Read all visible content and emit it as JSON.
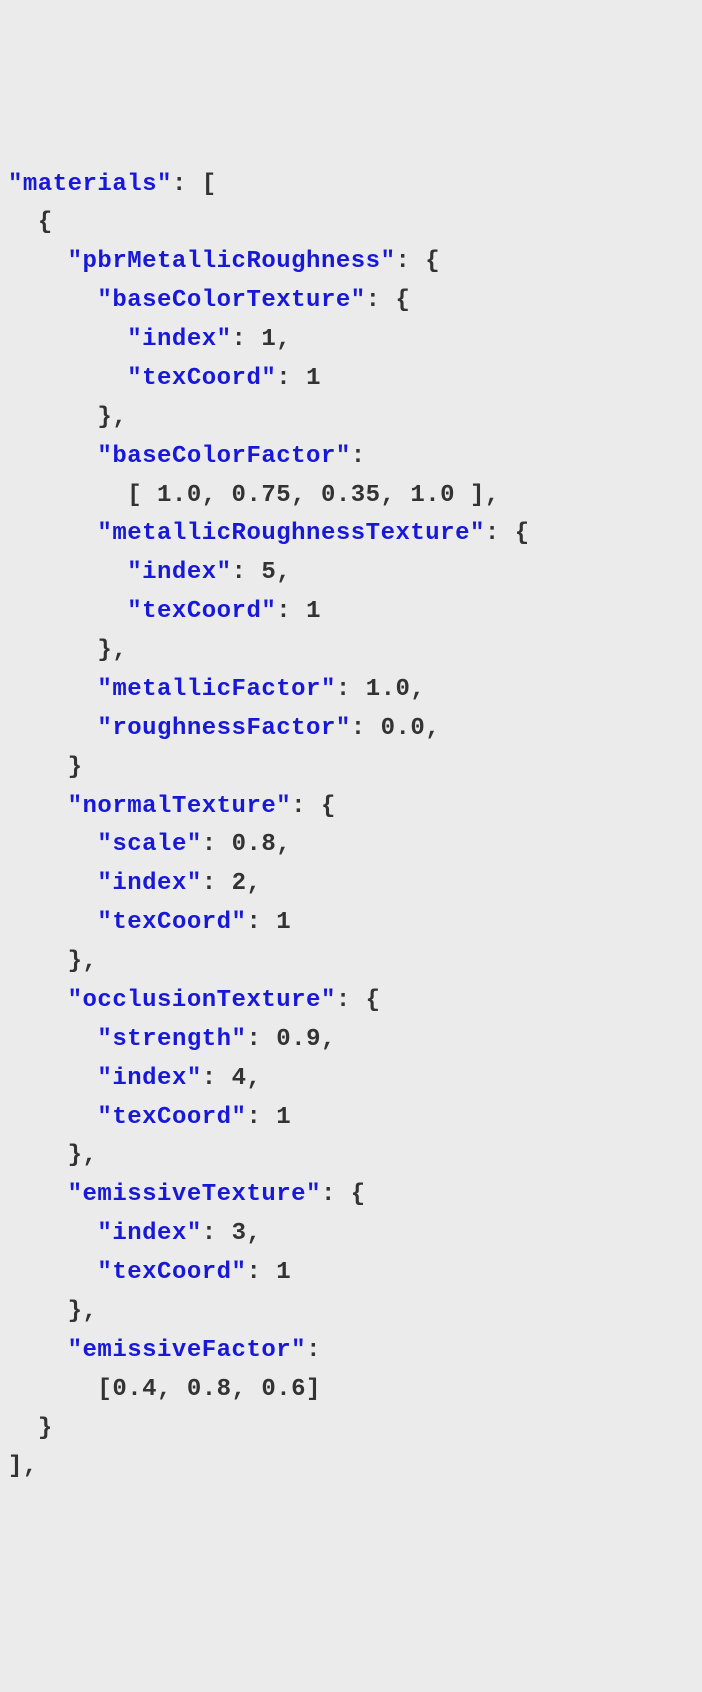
{
  "code": {
    "rootKey": "materials",
    "keys": {
      "pbrMetallicRoughness": "pbrMetallicRoughness",
      "baseColorTexture": "baseColorTexture",
      "index": "index",
      "texCoord": "texCoord",
      "baseColorFactor": "baseColorFactor",
      "metallicRoughnessTexture": "metallicRoughnessTexture",
      "metallicFactor": "metallicFactor",
      "roughnessFactor": "roughnessFactor",
      "normalTexture": "normalTexture",
      "scale": "scale",
      "occlusionTexture": "occlusionTexture",
      "strength": "strength",
      "emissiveTexture": "emissiveTexture",
      "emissiveFactor": "emissiveFactor"
    },
    "values": {
      "baseColorTexture_index": "1",
      "baseColorTexture_texCoord": "1",
      "baseColorFactor_array": "[ 1.0, 0.75, 0.35, 1.0 ]",
      "metallicRoughnessTexture_index": "5",
      "metallicRoughnessTexture_texCoord": "1",
      "metallicFactor": "1.0",
      "roughnessFactor": "0.0",
      "normalTexture_scale": "0.8",
      "normalTexture_index": "2",
      "normalTexture_texCoord": "1",
      "occlusionTexture_strength": "0.9",
      "occlusionTexture_index": "4",
      "occlusionTexture_texCoord": "1",
      "emissiveTexture_index": "3",
      "emissiveTexture_texCoord": "1",
      "emissiveFactor_array": "[0.4, 0.8, 0.6]"
    }
  }
}
